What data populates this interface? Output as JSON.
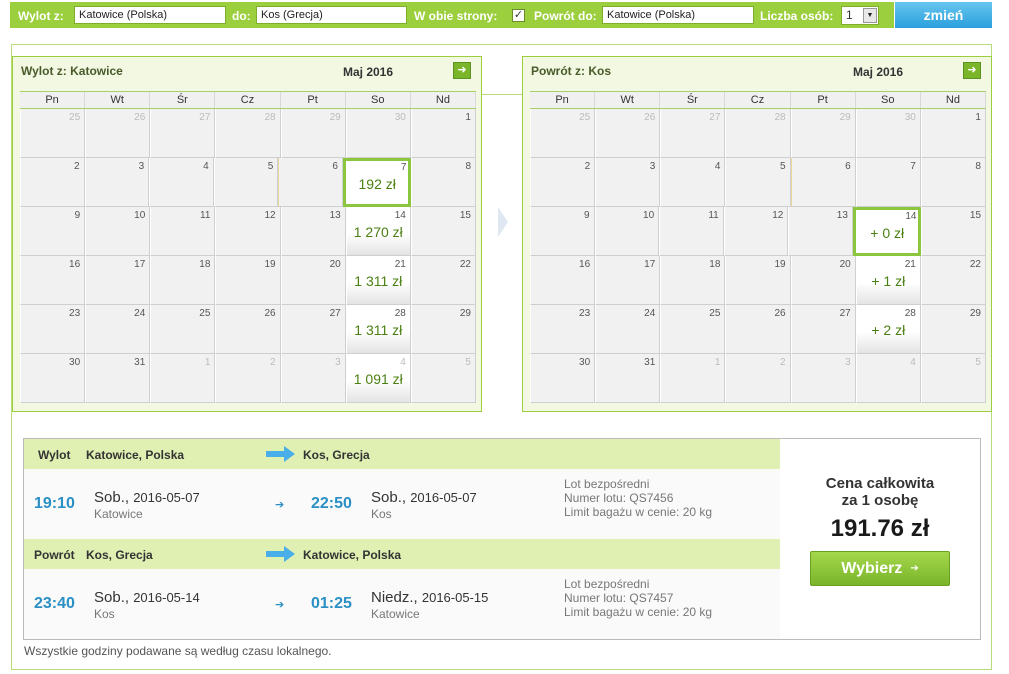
{
  "search": {
    "from_label": "Wylot z:",
    "from_value": "Katowice (Polska)",
    "to_label": "do:",
    "to_value": "Kos (Grecja)",
    "both_ways_label": "W obie strony:",
    "both_ways_checked": "✓",
    "return_label": "Powrót do:",
    "return_value": "Katowice (Polska)",
    "persons_label": "Liczba osób:",
    "persons_value": "1",
    "change_button": "zmień"
  },
  "calendars": [
    {
      "title": "Wylot z: Katowice",
      "month": "Maj 2016",
      "weekdays": [
        "Pn",
        "Wt",
        "Śr",
        "Cz",
        "Pt",
        "So",
        "Nd"
      ],
      "weeks": [
        [
          {
            "d": "25",
            "o": true
          },
          {
            "d": "26",
            "o": true
          },
          {
            "d": "27",
            "o": true
          },
          {
            "d": "28",
            "o": true
          },
          {
            "d": "29",
            "o": true
          },
          {
            "d": "30",
            "o": true
          },
          {
            "d": "1"
          }
        ],
        [
          {
            "d": "2"
          },
          {
            "d": "3"
          },
          {
            "d": "4"
          },
          {
            "d": "5"
          },
          {
            "d": "6",
            "ns": true
          },
          {
            "d": "7",
            "p": "192 zł",
            "sel": true
          },
          {
            "d": "8"
          }
        ],
        [
          {
            "d": "9"
          },
          {
            "d": "10"
          },
          {
            "d": "11"
          },
          {
            "d": "12"
          },
          {
            "d": "13"
          },
          {
            "d": "14",
            "p": "1 270 zł"
          },
          {
            "d": "15"
          }
        ],
        [
          {
            "d": "16"
          },
          {
            "d": "17"
          },
          {
            "d": "18"
          },
          {
            "d": "19"
          },
          {
            "d": "20"
          },
          {
            "d": "21",
            "p": "1 311 zł"
          },
          {
            "d": "22"
          }
        ],
        [
          {
            "d": "23"
          },
          {
            "d": "24"
          },
          {
            "d": "25"
          },
          {
            "d": "26"
          },
          {
            "d": "27"
          },
          {
            "d": "28",
            "p": "1 311 zł"
          },
          {
            "d": "29"
          }
        ],
        [
          {
            "d": "30"
          },
          {
            "d": "31"
          },
          {
            "d": "1",
            "o": true
          },
          {
            "d": "2",
            "o": true
          },
          {
            "d": "3",
            "o": true
          },
          {
            "d": "4",
            "o": true,
            "p": "1 091 zł"
          },
          {
            "d": "5",
            "o": true
          }
        ]
      ]
    },
    {
      "title": "Powrót z: Kos",
      "month": "Maj 2016",
      "weekdays": [
        "Pn",
        "Wt",
        "Śr",
        "Cz",
        "Pt",
        "So",
        "Nd"
      ],
      "weeks": [
        [
          {
            "d": "25",
            "o": true
          },
          {
            "d": "26",
            "o": true
          },
          {
            "d": "27",
            "o": true
          },
          {
            "d": "28",
            "o": true
          },
          {
            "d": "29",
            "o": true
          },
          {
            "d": "30",
            "o": true
          },
          {
            "d": "1"
          }
        ],
        [
          {
            "d": "2"
          },
          {
            "d": "3"
          },
          {
            "d": "4"
          },
          {
            "d": "5"
          },
          {
            "d": "6",
            "ns": true
          },
          {
            "d": "7"
          },
          {
            "d": "8"
          }
        ],
        [
          {
            "d": "9"
          },
          {
            "d": "10"
          },
          {
            "d": "11"
          },
          {
            "d": "12"
          },
          {
            "d": "13"
          },
          {
            "d": "14",
            "p": "+ 0 zł",
            "sel": true
          },
          {
            "d": "15"
          }
        ],
        [
          {
            "d": "16"
          },
          {
            "d": "17"
          },
          {
            "d": "18"
          },
          {
            "d": "19"
          },
          {
            "d": "20"
          },
          {
            "d": "21",
            "p": "+ 1 zł"
          },
          {
            "d": "22"
          }
        ],
        [
          {
            "d": "23"
          },
          {
            "d": "24"
          },
          {
            "d": "25"
          },
          {
            "d": "26"
          },
          {
            "d": "27"
          },
          {
            "d": "28",
            "p": "+ 2 zł"
          },
          {
            "d": "29"
          }
        ],
        [
          {
            "d": "30"
          },
          {
            "d": "31"
          },
          {
            "d": "1",
            "o": true
          },
          {
            "d": "2",
            "o": true
          },
          {
            "d": "3",
            "o": true
          },
          {
            "d": "4",
            "o": true
          },
          {
            "d": "5",
            "o": true
          }
        ]
      ]
    }
  ],
  "segments": [
    {
      "direction": "Wylot",
      "from": "Katowice, Polska",
      "to": "Kos, Grecja",
      "dep_time": "19:10",
      "dep_day": "Sob.,",
      "dep_date": "2016-05-07",
      "dep_city": "Katowice",
      "arr_time": "22:50",
      "arr_day": "Sob.,",
      "arr_date": "2016-05-07",
      "arr_city": "Kos",
      "info1": "Lot bezpośredni",
      "info2": "Numer lotu: QS7456",
      "info3": "Limit bagażu w cenie: 20 kg"
    },
    {
      "direction": "Powrót",
      "from": "Kos, Grecja",
      "to": "Katowice, Polska",
      "dep_time": "23:40",
      "dep_day": "Sob.,",
      "dep_date": "2016-05-14",
      "dep_city": "Kos",
      "arr_time": "01:25",
      "arr_day": "Niedz.,",
      "arr_date": "2016-05-15",
      "arr_city": "Katowice",
      "info1": "Lot bezpośredni",
      "info2": "Numer lotu: QS7457",
      "info3": "Limit bagażu w cenie: 20 kg"
    }
  ],
  "price": {
    "label_line1": "Cena całkowita",
    "label_line2": "za 1 osobę",
    "amount": "191.76 zł",
    "button": "Wybierz"
  },
  "footnote": "Wszystkie godziny podawane są według czasu lokalnego.",
  "colors": {
    "accent_green": "#9ccf3d",
    "button_blue": "#2a9fdc",
    "price_green": "#4a7f12"
  }
}
